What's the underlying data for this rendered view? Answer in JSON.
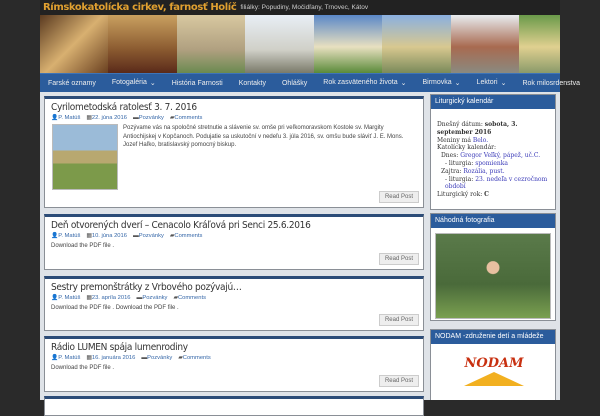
{
  "header": {
    "title": "Rímskokatolícka cirkev, farnosť Holíč",
    "description": "filiálky: Popudiny, Močidľany, Trnovec, Kátov"
  },
  "nav": [
    {
      "label": "Farské oznamy"
    },
    {
      "label": "Fotogaléria",
      "sub": "⌄"
    },
    {
      "label": "História Farnosti"
    },
    {
      "label": "Kontakty"
    },
    {
      "label": "Ohlášky"
    },
    {
      "label": "Rok zasväteného života",
      "sub": "⌄"
    },
    {
      "label": "Birmovka",
      "sub": "⌄"
    },
    {
      "label": "Lektori",
      "sub": "⌄"
    },
    {
      "label": "Rok milosrdenstva"
    }
  ],
  "posts": [
    {
      "title": "Cyrilometodská ratolesť 3. 7. 2016",
      "author": "P. Matúš",
      "date": "22. júna 2016",
      "category": "Pozvánky",
      "comments": "Comments",
      "excerpt": "Pozývame vás na spoločné stretnutie a slávenie sv. omše pri veľkomoravskom Kostole sv. Margity Antiochijskej v Kopčanoch. Podujatie sa uskutoční v nedeľu 3. júla 2016, sv. omšu bude sláviť J. E. Mons. Jozef Haľko, bratislavský pomocný biskup.",
      "read": "Read Post"
    },
    {
      "title": "Deň otvorených dverí – Cenacolo Kráľová pri Senci 25.6.2016",
      "author": "P. Matúš",
      "date": "10. júna 2016",
      "category": "Pozvánky",
      "comments": "Comments",
      "excerpt": "Download the PDF file .",
      "read": "Read Post"
    },
    {
      "title": "Sestry premonštrátky z Vrbového pozývajú…",
      "author": "P. Matúš",
      "date": "23. apríla 2016",
      "category": "Pozvánky",
      "comments": "Comments",
      "excerpt": "Download the PDF file . Download the PDF file .",
      "read": "Read Post"
    },
    {
      "title": "Rádio LUMEN spája lumenrodiny",
      "author": "P. Matúš",
      "date": "16. januára 2016",
      "category": "Pozvánky",
      "comments": "Comments",
      "excerpt": "Download the PDF file .",
      "read": "Read Post"
    }
  ],
  "sidebar": {
    "calendar": {
      "title": "Liturgický kalendár",
      "today_label": "Dnešný dátum:",
      "today": "sobota, 3. september 2016",
      "names_label": "Meniny má",
      "names": "Belo.",
      "cat_label": "Katolícky kalendár:",
      "dnes_label": "Dnes:",
      "dnes": "Gregor Veľký, pápež, uč.C.",
      "lit_label": "- liturgia:",
      "lit1": "spomienka",
      "zajtra_label": "Zajtra:",
      "zajtra": "Rozália, pust.",
      "lit2": "23. nedeľa v cezročnom období",
      "year_label": "Liturgický rok:",
      "year": "C"
    },
    "photo": {
      "title": "Náhodná fotografia"
    },
    "nodam": {
      "title": "NODAM -združenie detí a mládeže",
      "logo": "NODAM"
    }
  }
}
